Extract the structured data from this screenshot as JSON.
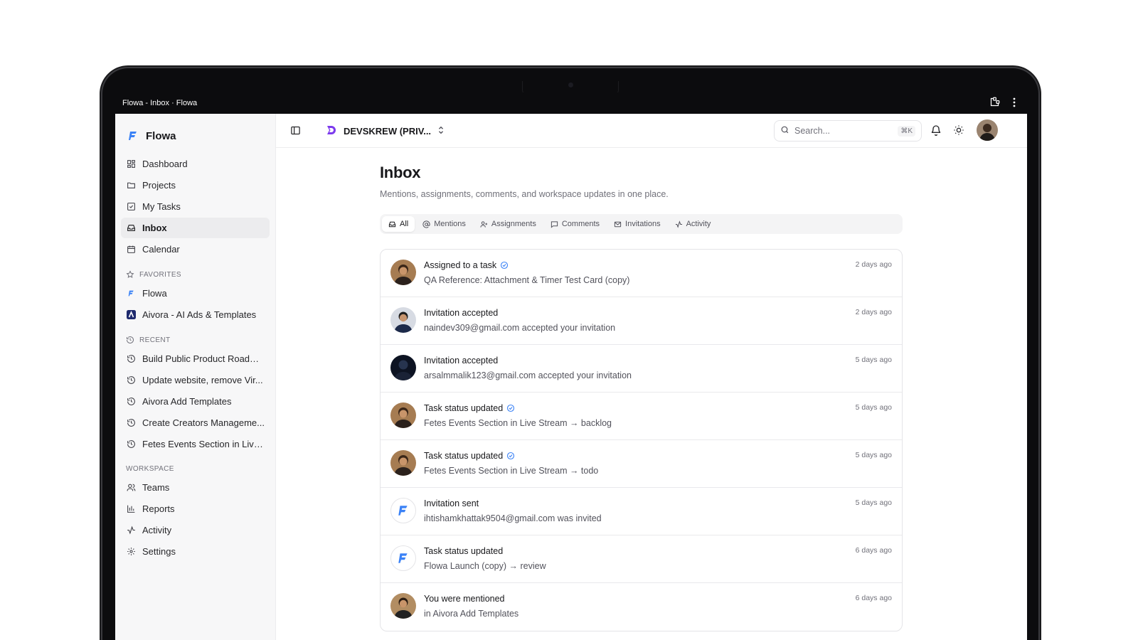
{
  "window": {
    "title": "Flowa - Inbox · Flowa"
  },
  "sidebar": {
    "brand": "Flowa",
    "nav": [
      {
        "label": "Dashboard",
        "icon": "grid-icon"
      },
      {
        "label": "Projects",
        "icon": "folder-icon"
      },
      {
        "label": "My Tasks",
        "icon": "checkbox-icon"
      },
      {
        "label": "Inbox",
        "icon": "inbox-icon",
        "active": true
      },
      {
        "label": "Calendar",
        "icon": "calendar-icon"
      }
    ],
    "favorites_label": "FAVORITES",
    "favorites": [
      {
        "label": "Flowa",
        "icon": "flowa-logo-icon"
      },
      {
        "label": "Aivora - AI Ads & Templates",
        "icon": "aivora-logo-icon"
      }
    ],
    "recent_label": "RECENT",
    "recent": [
      {
        "label": "Build Public Product Roadm..."
      },
      {
        "label": "Update website, remove Vir..."
      },
      {
        "label": "Aivora Add Templates"
      },
      {
        "label": "Create Creators Manageme..."
      },
      {
        "label": "Fetes Events Section in Live ..."
      }
    ],
    "workspace_label": "WORKSPACE",
    "workspace": [
      {
        "label": "Teams",
        "icon": "users-icon"
      },
      {
        "label": "Reports",
        "icon": "bar-chart-icon"
      },
      {
        "label": "Activity",
        "icon": "activity-icon"
      },
      {
        "label": "Settings",
        "icon": "gear-icon"
      }
    ]
  },
  "topbar": {
    "workspace_name": "DEVSKREW (PRIV...",
    "search_placeholder": "Search...",
    "search_shortcut": "⌘K"
  },
  "inbox": {
    "title": "Inbox",
    "subtitle": "Mentions, assignments, comments, and workspace updates in one place.",
    "tabs": [
      {
        "label": "All",
        "active": true
      },
      {
        "label": "Mentions"
      },
      {
        "label": "Assignments"
      },
      {
        "label": "Comments"
      },
      {
        "label": "Invitations"
      },
      {
        "label": "Activity"
      }
    ],
    "items": [
      {
        "title": "Assigned to a task",
        "verified": true,
        "detail": "QA Reference: Attachment & Timer Test Card (copy)",
        "time": "2 days ago",
        "avatar": "person-a"
      },
      {
        "title": "Invitation accepted",
        "verified": false,
        "detail": "naindev309@gmail.com accepted your invitation",
        "time": "2 days ago",
        "avatar": "person-b"
      },
      {
        "title": "Invitation accepted",
        "verified": false,
        "detail": "arsalmmalik123@gmail.com accepted your invitation",
        "time": "5 days ago",
        "avatar": "person-c"
      },
      {
        "title": "Task status updated",
        "verified": true,
        "detail": "Fetes Events Section in Live Stream → backlog",
        "time": "5 days ago",
        "avatar": "person-a"
      },
      {
        "title": "Task status updated",
        "verified": true,
        "detail": "Fetes Events Section in Live Stream → todo",
        "time": "5 days ago",
        "avatar": "person-a"
      },
      {
        "title": "Invitation sent",
        "verified": false,
        "detail": "ihtishamkhattak9504@gmail.com was invited",
        "time": "5 days ago",
        "avatar": "flowa-logo"
      },
      {
        "title": "Task status updated",
        "verified": false,
        "detail": "Flowa Launch (copy) → review",
        "time": "6 days ago",
        "avatar": "flowa-logo"
      },
      {
        "title": "You were mentioned",
        "verified": false,
        "detail": "in Aivora Add Templates",
        "time": "6 days ago",
        "avatar": "person-d"
      }
    ]
  },
  "colors": {
    "accent": "#3b82f6",
    "brand_purple": "#7c3aed",
    "sidebar_bg": "#f7f7f8"
  }
}
